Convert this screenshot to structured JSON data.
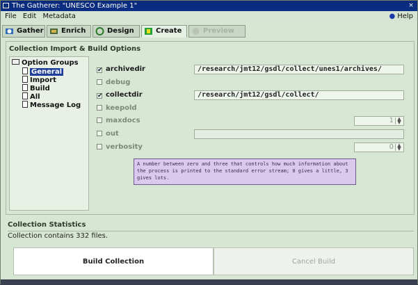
{
  "window": {
    "title": "The Gatherer: \"UNESCO Example 1\"",
    "close_glyph": "×"
  },
  "menu": {
    "items": [
      "File",
      "Edit",
      "Metadata"
    ],
    "help": "Help"
  },
  "tabs": [
    {
      "label": "Gather",
      "state": "normal",
      "icon": "gather-icon"
    },
    {
      "label": "Enrich",
      "state": "normal",
      "icon": "enrich-icon"
    },
    {
      "label": "Design",
      "state": "normal",
      "icon": "design-icon"
    },
    {
      "label": "Create",
      "state": "active",
      "icon": "create-icon"
    },
    {
      "label": "Preview",
      "state": "disabled",
      "icon": "preview-icon"
    }
  ],
  "section_title": "Collection Import & Build Options",
  "option_groups": {
    "root": "Option Groups",
    "items": [
      "General",
      "Import",
      "Build",
      "All",
      "Message Log"
    ],
    "selected": "General"
  },
  "options": [
    {
      "name": "archivedir",
      "checked": true,
      "value": "/research/jmt12/gsdl/collect/unes1/archives/"
    },
    {
      "name": "debug",
      "checked": false
    },
    {
      "name": "collectdir",
      "checked": true,
      "value": "/research/jmt12/gsdl/collect/"
    },
    {
      "name": "keepold",
      "checked": false
    },
    {
      "name": "maxdocs",
      "checked": false,
      "spin": "1"
    },
    {
      "name": "out",
      "checked": false,
      "value": ""
    },
    {
      "name": "verbosity",
      "checked": false,
      "spin": "0"
    }
  ],
  "tooltip": "A number between zero and three that controls how much information about the process is printed to the standard error stream; 0 gives a little, 3 gives lots.",
  "stats": {
    "title": "Collection Statistics",
    "text": "Collection contains 332 files."
  },
  "buttons": {
    "build": "Build Collection",
    "cancel": "Cancel Build"
  },
  "colors": {
    "accent": "#1f3f9a",
    "tooltip_bg": "#d9c9ec",
    "panel_bg": "#d8e6d4"
  }
}
